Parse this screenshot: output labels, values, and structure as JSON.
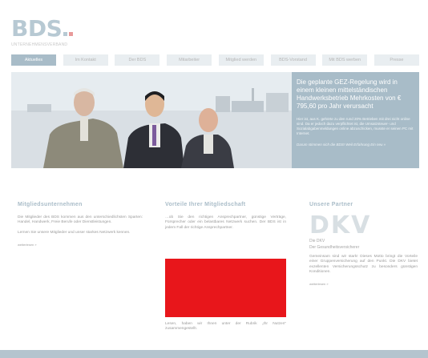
{
  "logo": {
    "text": "BDS",
    "tagline": "UNTERNEHMENSVERBAND"
  },
  "nav": {
    "items": [
      "Aktuelles",
      "Im Kontakt",
      "Der BDS",
      "Mitarbeiter",
      "Mitglied werden",
      "BDS-Vorstand",
      "Mit BDS werben",
      "Presse"
    ]
  },
  "hero": {
    "headline": "Die geplante GEZ-Regelung wird in einem kleinen mittelständischen Handwerksbetrieb Mehrkosten von € 795,60 pro Jahr verursacht",
    "text": "Hier ist, aus K. gehörte zu den rund 20% Betrieben mit drei nicht online sind. Da er jedoch dazu verpflichtet ist, die Umsatzsteuer- und Sozialabgabenmeldungen online abzuschicken, musste er seinen PC mit Internet.",
    "link": "Darum stimmen sich die BDS! Weil Erfahrung Ein neu »"
  },
  "members": {
    "title": "Mitgliedsunternehmen",
    "text": "Die Mitglieder des BDS kommen aus den unterschiedlichsten Sparten: Handel, Handwerk, Freie Berufe oder Dienstleistungen.",
    "text2": "Lernen Sie unsere Mitglieder und unser starkes Netzwerk kennen.",
    "link": "weiterlesen »"
  },
  "benefits": {
    "title": "Vorteile Ihrer Mitgliedschaft",
    "text": "…ob Sie den richtigen Ansprechpartner, günstige Verträge, Fürsprecher oder ein belastbares Netzwerk suchen. Der BDS ist in jedem Fall der richtige Ansprechpartner.",
    "text2": "Lesen, haben wir Ihnen unter der Rubrik „Ihr Nutzen“ zusammengestellt."
  },
  "partners": {
    "title": "Unsere Partner",
    "logo": "DKV",
    "caption1": "Die DKV",
    "caption2": "Der Gesundheitsversicherer",
    "text": "Gemeinsam sind wir stark! Dieses Motto bringt die Vorteile einer Gruppenversicherung auf den Punkt. Die DKV bietet exzellenten Versicherungsschutz zu besonders günstigen Konditionen.",
    "link": "weiterlesen »"
  },
  "colors": {
    "accent": "#a8bcc8",
    "video": "#e8161b",
    "logo_red": "#e89a9a"
  }
}
